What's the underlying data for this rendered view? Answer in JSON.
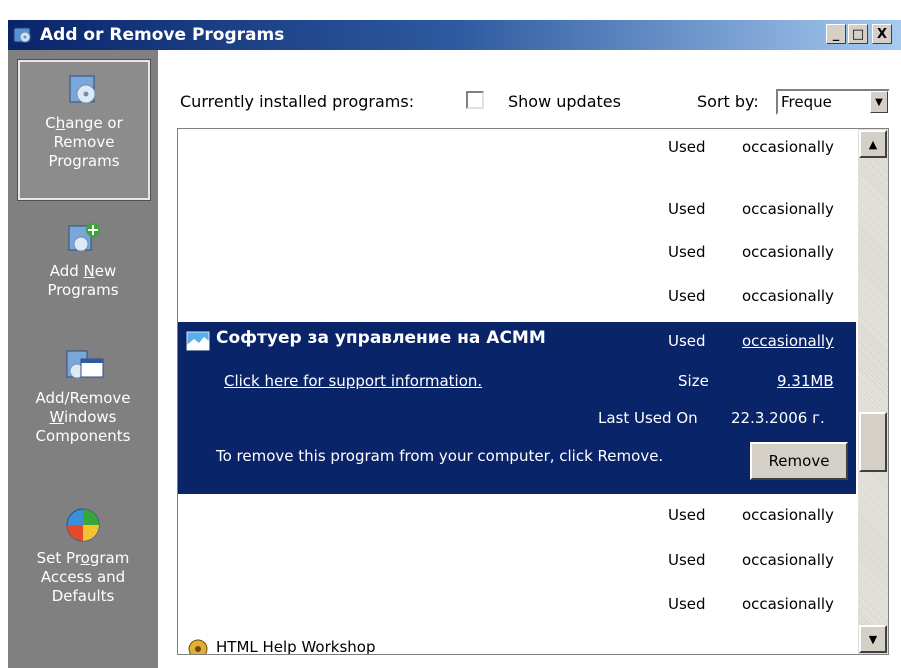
{
  "window": {
    "title": "Add or Remove Programs",
    "controls": [
      "_",
      "□",
      "X"
    ]
  },
  "sidebar": {
    "items": [
      {
        "label_pre": "C",
        "label_u": "h",
        "label_post": "ange or",
        "label2": "Remove",
        "label3": "Programs",
        "icon": "change-remove-programs-icon",
        "active": true
      },
      {
        "label_pre": "Add ",
        "label_u": "N",
        "label_post": "ew",
        "label2": "Programs",
        "icon": "add-new-programs-icon"
      },
      {
        "label": "Add/Remove",
        "label2_u": "W",
        "label2_post": "indows",
        "label3": "Components",
        "icon": "windows-components-icon"
      },
      {
        "label_pre": "Set Pr",
        "label_u": "o",
        "label_post": "gram",
        "label2": "Access and",
        "label3": "Defaults",
        "icon": "program-access-defaults-icon"
      }
    ]
  },
  "toolbar": {
    "installed_label": "Currently installed programs:",
    "show_updates_label": "Show updates",
    "sort_label": "Sort by:",
    "sort_value": "Freque"
  },
  "list": {
    "rows_top": [
      {
        "used": "Used",
        "frequency": "occasionally"
      },
      {
        "used": "Used",
        "frequency": "occasionally"
      },
      {
        "used": "Used",
        "frequency": "occasionally"
      },
      {
        "used": "Used",
        "frequency": "occasionally"
      }
    ],
    "selected": {
      "name": "Софтуер за управление на АСММ",
      "used": "Used",
      "frequency": "occasionally",
      "support_link": "Click here for support information.",
      "size_label": "Size",
      "size_value": "9.31MB",
      "last_used_label": "Last Used On",
      "last_used_value": "22.3.2006 г.",
      "remove_text": "To remove this program from your computer, click Remove.",
      "remove_button": "Remove"
    },
    "rows_bottom": [
      {
        "used": "Used",
        "frequency": "occasionally"
      },
      {
        "used": "Used",
        "frequency": "occasionally"
      },
      {
        "used": "Used",
        "frequency": "occasionally"
      }
    ],
    "partial_row_name": "HTML Help Workshop"
  },
  "colors": {
    "selection": "#0a246a",
    "sidebar": "#808080",
    "button_face": "#d4d0c8"
  }
}
